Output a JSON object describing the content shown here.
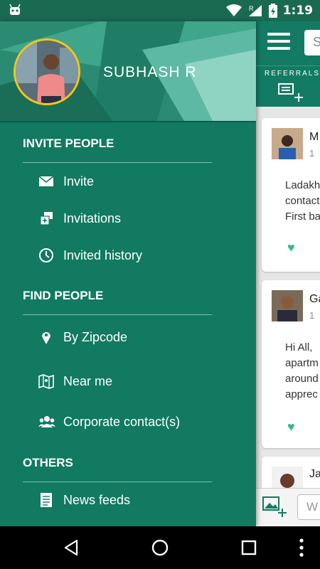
{
  "status_bar": {
    "time": "1:19",
    "signal_label": "R"
  },
  "drawer": {
    "user_name": "SUBHASH R",
    "sections": [
      {
        "title": "INVITE PEOPLE",
        "items": [
          {
            "label": "Invite",
            "icon": "envelope-icon"
          },
          {
            "label": "Invitations",
            "icon": "invitations-icon"
          },
          {
            "label": "Invited history",
            "icon": "clock-icon"
          }
        ]
      },
      {
        "title": "FIND PEOPLE",
        "items": [
          {
            "label": "By Zipcode",
            "icon": "location-pin-icon"
          },
          {
            "label": "Near me",
            "icon": "map-icon"
          },
          {
            "label": "Corporate contact(s)",
            "icon": "group-icon"
          }
        ]
      },
      {
        "title": "OTHERS",
        "items": [
          {
            "label": "News feeds",
            "icon": "document-icon"
          }
        ]
      }
    ]
  },
  "background_app": {
    "search_placeholder": "S",
    "referrals_label": "REFERRALS",
    "posts": [
      {
        "name": "M",
        "sub": "1",
        "text": "Ladakh\ncontact\nFirst ba"
      },
      {
        "name": "Ga",
        "sub": "1",
        "text": "Hi All,\napartm\naround\napprec"
      },
      {
        "name": "Ja",
        "sub": "",
        "text": ""
      }
    ],
    "composer_placeholder": "W"
  },
  "colors": {
    "drawer_bg": "#117a60",
    "accent_heart": "#3cb68f",
    "avatar_ring": "#f5c518"
  }
}
